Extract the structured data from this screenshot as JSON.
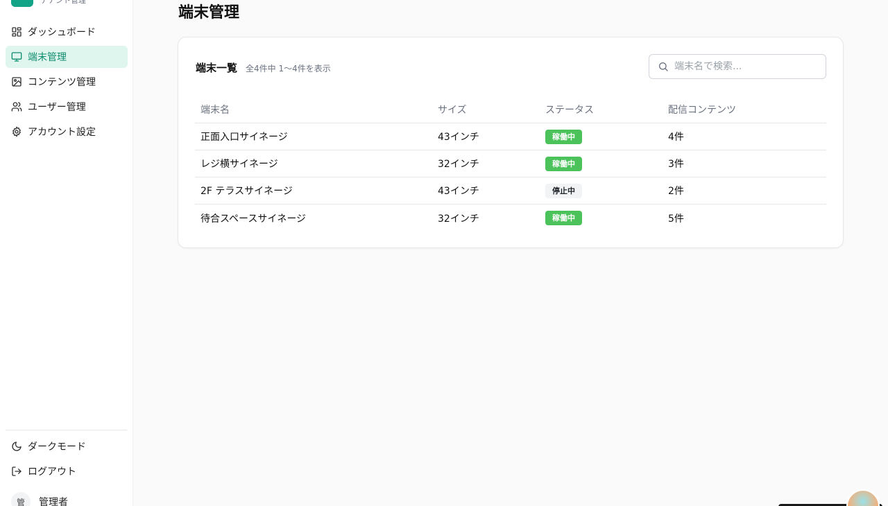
{
  "brand": {
    "subtitle": "テナント管理"
  },
  "sidebar": {
    "items": [
      {
        "label": "ダッシュボード",
        "icon": "dashboard-icon"
      },
      {
        "label": "端末管理",
        "icon": "monitor-icon",
        "active": true
      },
      {
        "label": "コンテンツ管理",
        "icon": "image-icon"
      },
      {
        "label": "ユーザー管理",
        "icon": "users-icon"
      },
      {
        "label": "アカウント設定",
        "icon": "gear-icon"
      }
    ],
    "bottom": [
      {
        "label": "ダークモード",
        "icon": "moon-icon"
      },
      {
        "label": "ログアウト",
        "icon": "logout-icon"
      }
    ],
    "user": {
      "avatar": "管",
      "name": "管理者"
    }
  },
  "main": {
    "title": "端末管理",
    "card": {
      "title": "端末一覧",
      "count": "全4件中 1〜4件を表示",
      "search_placeholder": "端末名で検索..."
    },
    "table": {
      "headers": [
        "端末名",
        "サイズ",
        "ステータス",
        "配信コンテンツ"
      ],
      "rows": [
        {
          "name": "正面入口サイネージ",
          "size": "43インチ",
          "status": "稼働中",
          "content": "4件"
        },
        {
          "name": "レジ横サイネージ",
          "size": "32インチ",
          "status": "稼働中",
          "content": "3件"
        },
        {
          "name": "2F テラスサイネージ",
          "size": "43インチ",
          "status": "停止中",
          "content": "2件"
        },
        {
          "name": "待合スペースサイネージ",
          "size": "32インチ",
          "status": "稼働中",
          "content": "5件"
        }
      ]
    }
  },
  "colors": {
    "accent": "#13a387",
    "active_bg": "#dff6ee",
    "running": "#4cc35a",
    "stopped_bg": "#f1f3f5"
  }
}
